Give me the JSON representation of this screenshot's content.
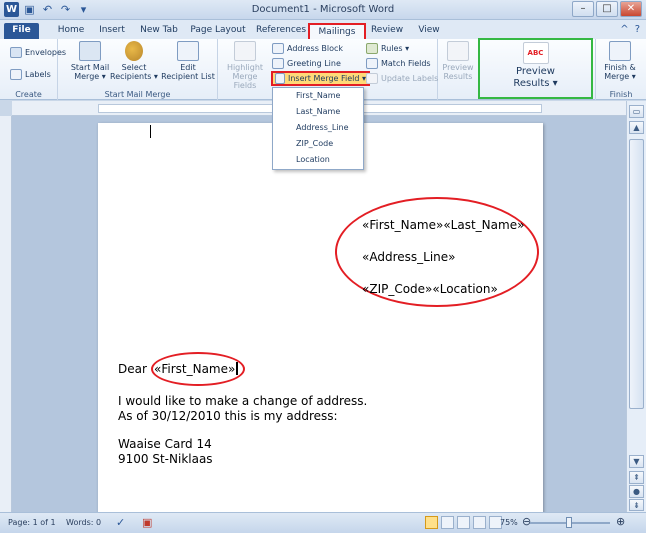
{
  "window": {
    "title": "Document1 - Microsoft Word",
    "controls": {
      "minimize": "–",
      "maximize": "□",
      "close": "✕"
    }
  },
  "quick_access": {
    "app_icon": "W",
    "icons": [
      "save-icon",
      "undo-icon",
      "redo-icon",
      "customize-icon"
    ]
  },
  "tabs": [
    {
      "label": "File"
    },
    {
      "label": "Home"
    },
    {
      "label": "Insert"
    },
    {
      "label": "New Tab"
    },
    {
      "label": "Page Layout"
    },
    {
      "label": "References"
    },
    {
      "label": "Mailings"
    },
    {
      "label": "Review"
    },
    {
      "label": "View"
    }
  ],
  "ribbon": {
    "create": {
      "label": "Create",
      "envelopes": "Envelopes",
      "labels": "Labels"
    },
    "start_mail_merge": {
      "label": "Start Mail Merge",
      "start_line1": "Start Mail",
      "start_line2": "Merge ▾",
      "select_line1": "Select",
      "select_line2": "Recipients ▾",
      "edit_line1": "Edit",
      "edit_line2": "Recipient List"
    },
    "write_insert": {
      "highlight_line1": "Highlight",
      "highlight_line2": "Merge Fields",
      "address_block": "Address Block",
      "greeting_line": "Greeting Line",
      "insert_merge_field": "Insert Merge Field ▾",
      "rules": "Rules ▾",
      "match_fields": "Match Fields",
      "update_labels": "Update Labels"
    },
    "preview": {
      "preview_line1": "Preview",
      "preview_line2": "Results",
      "big_line1": "Preview",
      "big_line2": "Results ▾",
      "icon_text": "ABC"
    },
    "finish": {
      "label": "Finish",
      "line1": "Finish &",
      "line2": "Merge ▾"
    }
  },
  "merge_field_menu": [
    "First_Name",
    "Last_Name",
    "Address_Line",
    "ZIP_Code",
    "Location"
  ],
  "document": {
    "address_block": [
      "«First_Name»«Last_Name»",
      "«Address_Line»",
      "«ZIP_Code»«Location»"
    ],
    "greeting_prefix": "Dear",
    "greeting_field": "«First_Name»",
    "body_lines": [
      "I would like to make a change of address.",
      "As of 30/12/2010 this is my address:"
    ],
    "address_lines": [
      "Waaise Card 14",
      "9100 St-Niklaas"
    ]
  },
  "status": {
    "page": "Page: 1 of 1",
    "words": "Words: 0",
    "zoom": "75%",
    "zoom_level_percent": 75
  },
  "colors": {
    "highlight_red": "#e31e24",
    "preview_green": "#35b843",
    "file_tab": "#2b5797"
  }
}
